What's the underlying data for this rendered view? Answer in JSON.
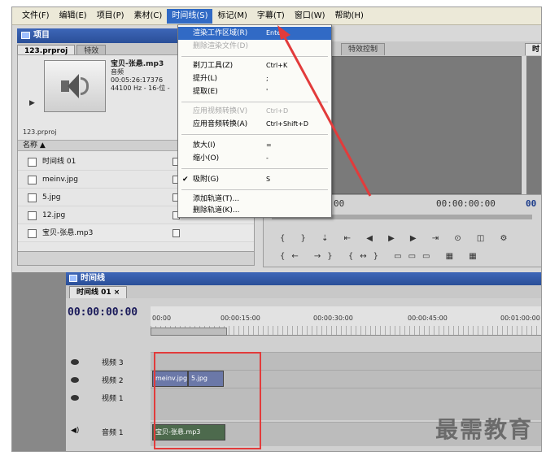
{
  "menubar": {
    "items": [
      {
        "label": "文件(F)"
      },
      {
        "label": "编辑(E)"
      },
      {
        "label": "项目(P)"
      },
      {
        "label": "素材(C)"
      },
      {
        "label": "时间线(S)"
      },
      {
        "label": "标记(M)"
      },
      {
        "label": "字幕(T)"
      },
      {
        "label": "窗口(W)"
      },
      {
        "label": "帮助(H)"
      }
    ],
    "active_index": 4
  },
  "project_panel": {
    "title": "项目",
    "tabs": [
      {
        "label": "123.prproj"
      },
      {
        "label": "特效"
      }
    ],
    "clip": {
      "name": "宝贝-张悬.mp3",
      "type": "音频",
      "duration": "00:05:26:17376",
      "format": "44100 Hz - 16-位 -"
    },
    "project_name": "123.prproj",
    "column_name": "名称",
    "files": [
      {
        "name": "时间线 01"
      },
      {
        "name": "meinv.jpg"
      },
      {
        "name": "5.jpg"
      },
      {
        "name": "12.jpg"
      },
      {
        "name": "宝贝-张悬.mp3"
      }
    ]
  },
  "timeline_menu": {
    "items": [
      {
        "label": "渲染工作区域(R)",
        "shortcut": "Enter",
        "state": "highlighted"
      },
      {
        "label": "删除渲染文件(D)",
        "shortcut": "",
        "state": "disabled"
      },
      {
        "label": "剃刀工具(Z)",
        "shortcut": "Ctrl+K",
        "state": "normal"
      },
      {
        "label": "提升(L)",
        "shortcut": ";",
        "state": "normal"
      },
      {
        "label": "提取(E)",
        "shortcut": "'",
        "state": "normal"
      },
      {
        "label": "应用视频转换(V)",
        "shortcut": "Ctrl+D",
        "state": "disabled"
      },
      {
        "label": "应用音频转换(A)",
        "shortcut": "Ctrl+Shift+D",
        "state": "normal"
      },
      {
        "label": "放大(I)",
        "shortcut": "=",
        "state": "normal"
      },
      {
        "label": "缩小(O)",
        "shortcut": "-",
        "state": "normal"
      },
      {
        "label": "吸附(G)",
        "shortcut": "S",
        "state": "checked"
      },
      {
        "label": "添加轨道(T)...",
        "shortcut": "",
        "state": "normal"
      },
      {
        "label": "删除轨道(K)...",
        "shortcut": "",
        "state": "normal"
      }
    ]
  },
  "monitor": {
    "tab_label": "特效控制",
    "right_tab": "时",
    "timecode_left": "00",
    "timecode_right": "00:00:00:00",
    "timecode_far": "00"
  },
  "timeline_panel": {
    "title": "时间线",
    "tab": "时间线 01",
    "current_time": "00:00:00:00",
    "ruler_labels": [
      "00:00",
      "00:00:15:00",
      "00:00:30:00",
      "00:00:45:00",
      "00:01:00:00"
    ],
    "tracks": [
      {
        "label": "视频 3"
      },
      {
        "label": "视频 2"
      },
      {
        "label": "视频 1"
      },
      {
        "label": "音频 1"
      }
    ],
    "clips": [
      {
        "label": "meinv.jpg",
        "track": "视频 2"
      },
      {
        "label": "5.jpg",
        "track": "视频 2"
      },
      {
        "label": "宝贝-张悬.mp3",
        "track": "音频 1"
      }
    ]
  },
  "watermark": "最需教育",
  "colors": {
    "highlight": "#316ac5",
    "annotation": "#e23b3b",
    "title_bar": "#2a4f98"
  }
}
